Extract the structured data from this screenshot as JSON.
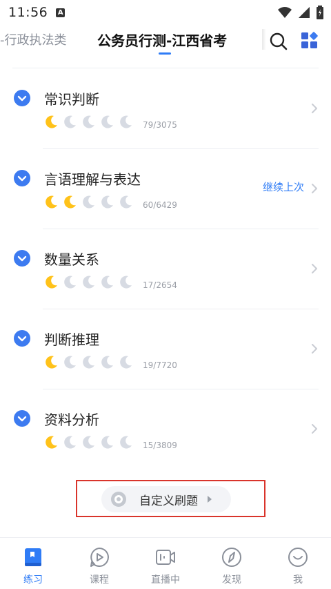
{
  "status_bar": {
    "time": "11:56",
    "notification_glyph": "A"
  },
  "header": {
    "tab_prev": "-行政执法类",
    "tab_current": "公务员行测-江西省考",
    "accent_color": "#2f7cf6"
  },
  "list": {
    "items": [
      {
        "title": "常识判断",
        "count": "79/3075",
        "level": 1,
        "max_level": 5,
        "action": ""
      },
      {
        "title": "言语理解与表达",
        "count": "60/6429",
        "level": 2,
        "max_level": 5,
        "action": "继续上次"
      },
      {
        "title": "数量关系",
        "count": "17/2654",
        "level": 1,
        "max_level": 5,
        "action": ""
      },
      {
        "title": "判断推理",
        "count": "19/7720",
        "level": 1,
        "max_level": 5,
        "action": ""
      },
      {
        "title": "资料分析",
        "count": "15/3809",
        "level": 1,
        "max_level": 5,
        "action": ""
      }
    ]
  },
  "custom_practice": {
    "label": "自定义刷题",
    "icon": "disc-icon"
  },
  "bottom_nav": {
    "active": 0,
    "items": [
      {
        "label": "练习",
        "icon": "book-icon"
      },
      {
        "label": "课程",
        "icon": "play-icon"
      },
      {
        "label": "直播中",
        "icon": "live-camera-icon"
      },
      {
        "label": "发现",
        "icon": "compass-icon"
      },
      {
        "label": "我",
        "icon": "smile-icon"
      }
    ]
  },
  "colors": {
    "moon_filled": "#ffc21a",
    "moon_empty": "#d7dbe3",
    "badge_blue": "#3d7bf0",
    "highlight_red": "#d9342b"
  }
}
